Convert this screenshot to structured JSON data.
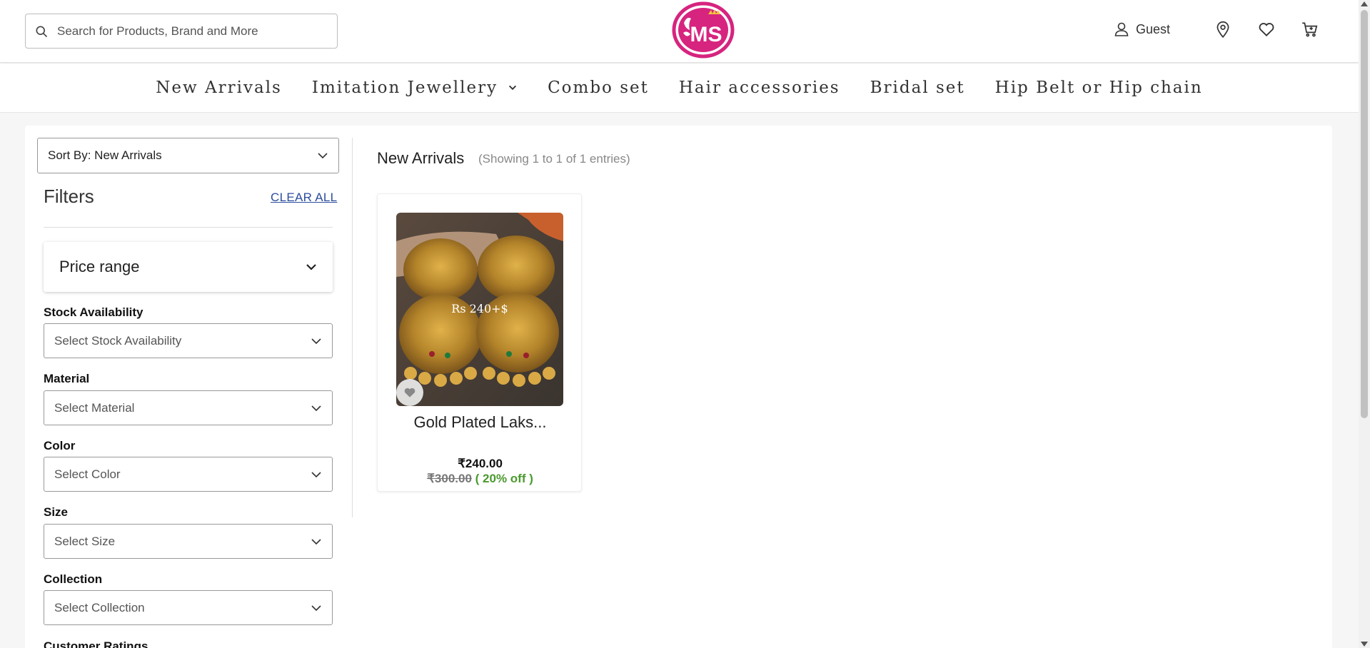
{
  "header": {
    "search_placeholder": "Search for Products, Brand and More",
    "logo_text": "MS",
    "user_label": "Guest"
  },
  "nav": {
    "items": [
      {
        "label": "New Arrivals"
      },
      {
        "label": "Imitation Jewellery"
      },
      {
        "label": "Combo set"
      },
      {
        "label": "Hair accessories"
      },
      {
        "label": "Bridal set"
      },
      {
        "label": "Hip Belt or Hip chain"
      }
    ]
  },
  "sidebar": {
    "sort_label": "Sort By: New Arrivals",
    "filters_title": "Filters",
    "clear_all": "CLEAR ALL",
    "price_range": "Price range",
    "filters": [
      {
        "label": "Stock Availability",
        "placeholder": "Select Stock Availability"
      },
      {
        "label": "Material",
        "placeholder": "Select Material"
      },
      {
        "label": "Color",
        "placeholder": "Select Color"
      },
      {
        "label": "Size",
        "placeholder": "Select Size"
      },
      {
        "label": "Collection",
        "placeholder": "Select Collection"
      },
      {
        "label": "Customer Ratings"
      }
    ]
  },
  "content": {
    "title": "New Arrivals",
    "count": "(Showing 1 to 1 of 1 entries)",
    "products": [
      {
        "name": "Gold Plated Laks...",
        "image_caption": "Rs 240+$",
        "price": "₹240.00",
        "mrp": "₹300.00",
        "discount": "( 20% off )"
      }
    ]
  },
  "colors": {
    "brand": "#d6247f",
    "link": "#2c4c9c",
    "discount": "#4a9a2d"
  }
}
